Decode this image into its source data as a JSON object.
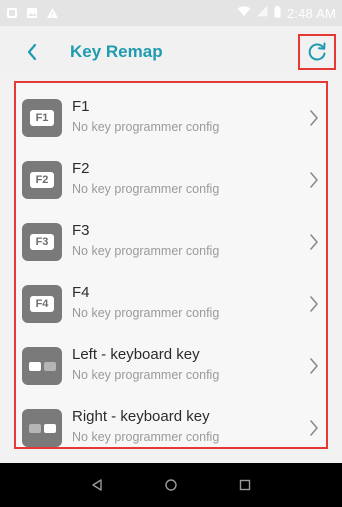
{
  "status_bar": {
    "time": "2:48 AM",
    "icons": [
      "app-notification-icon",
      "image-notification-icon",
      "warning-icon",
      "wifi-icon",
      "signal-off-icon",
      "battery-icon"
    ]
  },
  "app_bar": {
    "title": "Key Remap",
    "back_icon": "chevron-left-icon",
    "refresh_icon": "refresh-icon",
    "accent_color": "#1f9bb0"
  },
  "highlight_color": "#e53935",
  "keys": [
    {
      "name": "F1",
      "glyph": "F1",
      "status": "No key programmer config"
    },
    {
      "name": "F2",
      "glyph": "F2",
      "status": "No key programmer config"
    },
    {
      "name": "F3",
      "glyph": "F3",
      "status": "No key programmer config"
    },
    {
      "name": "F4",
      "glyph": "F4",
      "status": "No key programmer config"
    },
    {
      "name": "Left - keyboard key",
      "glyph": "left-arrow-key",
      "status": "No key programmer config"
    },
    {
      "name": "Right - keyboard key",
      "glyph": "right-arrow-key",
      "status": "No key programmer config"
    }
  ],
  "nav_bar": {
    "buttons": [
      "back-triangle-icon",
      "home-circle-icon",
      "recents-square-icon"
    ]
  }
}
